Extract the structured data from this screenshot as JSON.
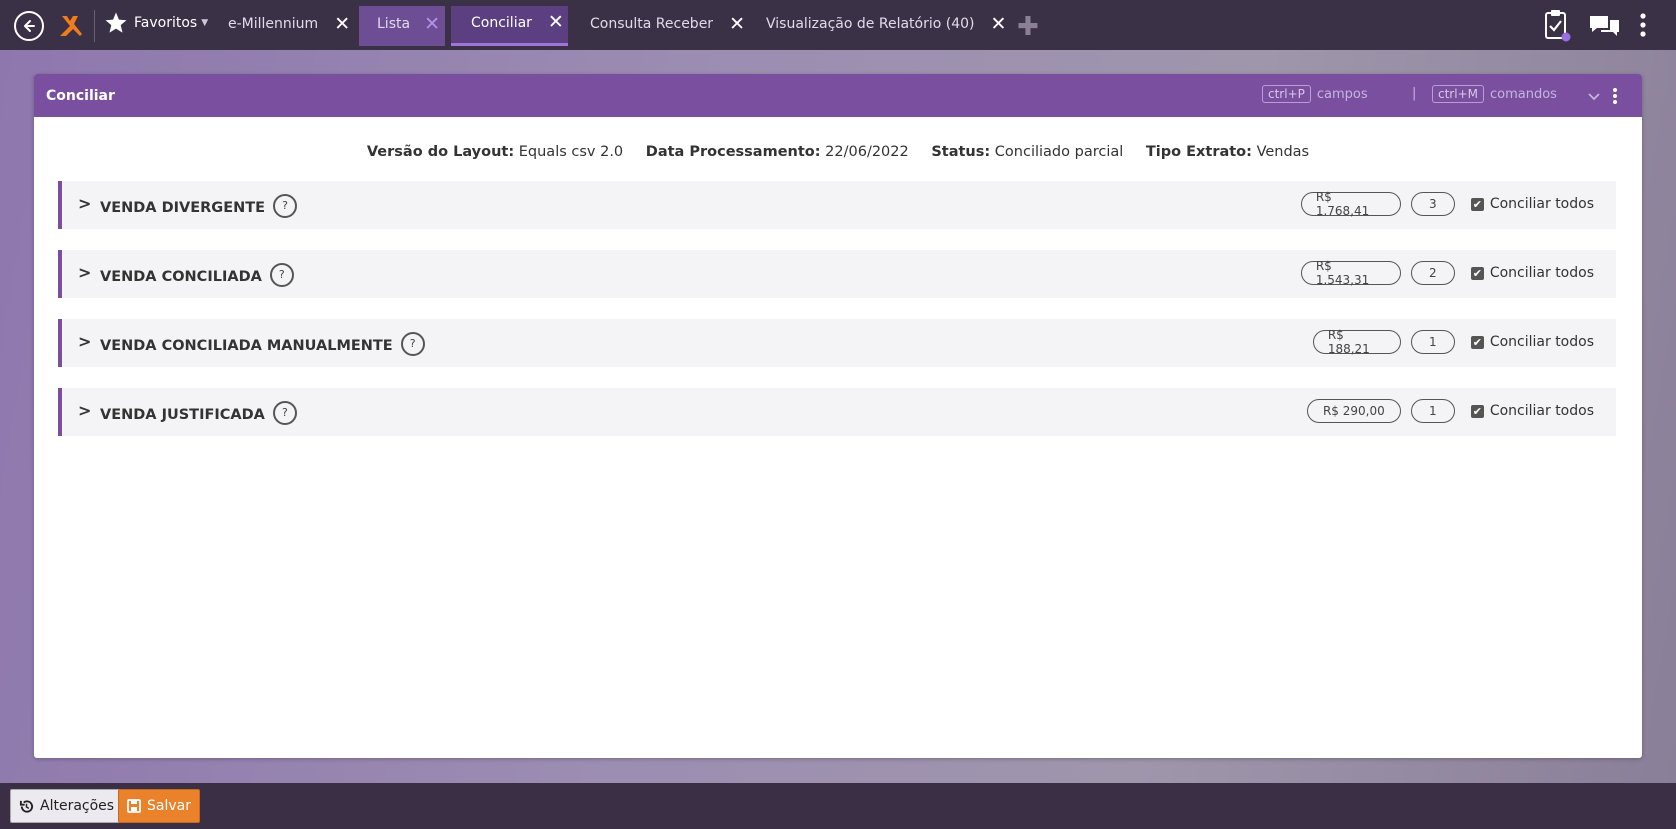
{
  "topbar": {
    "favorites_label": "Favoritos",
    "tabs": [
      {
        "label": "e-Millennium"
      },
      {
        "label": "Lista"
      },
      {
        "label": "Conciliar"
      },
      {
        "label": "Consulta Receber"
      },
      {
        "label": "Visualização de Relatório (40)"
      }
    ],
    "icons": [
      "back-arrow-icon",
      "app-logo-icon",
      "star-icon",
      "plus-icon",
      "clipboard-check-icon",
      "chat-icon",
      "more-vertical-icon"
    ]
  },
  "panel": {
    "title": "Conciliar",
    "hotkeys": [
      {
        "key": "ctrl+P",
        "label": "campos"
      },
      {
        "key": "ctrl+M",
        "label": "comandos"
      }
    ],
    "meta": {
      "layout_label": "Versão do Layout:",
      "layout_value": "Equals csv 2.0",
      "date_label": "Data Processamento:",
      "date_value": "22/06/2022",
      "status_label": "Status:",
      "status_value": "Conciliado parcial",
      "extract_label": "Tipo Extrato:",
      "extract_value": "Vendas"
    },
    "sections": [
      {
        "title": "VENDA DIVERGENTE",
        "amount": "R$ 1.768,41",
        "count": "3",
        "checkbox_label": "Conciliar todos",
        "checked": true
      },
      {
        "title": "VENDA CONCILIADA",
        "amount": "R$ 1.543,31",
        "count": "2",
        "checkbox_label": "Conciliar todos",
        "checked": true
      },
      {
        "title": "VENDA CONCILIADA MANUALMENTE",
        "amount": "R$ 188,21",
        "count": "1",
        "checkbox_label": "Conciliar todos",
        "checked": true
      },
      {
        "title": "VENDA JUSTIFICADA",
        "amount": "R$ 290,00",
        "count": "1",
        "checkbox_label": "Conciliar todos",
        "checked": true
      }
    ]
  },
  "bottom": {
    "changes_label": "Alterações",
    "save_label": "Salvar"
  },
  "colors": {
    "accent_purple": "#7a4fa0",
    "topbar_bg": "#3b3147",
    "save_orange": "#e9822a"
  }
}
